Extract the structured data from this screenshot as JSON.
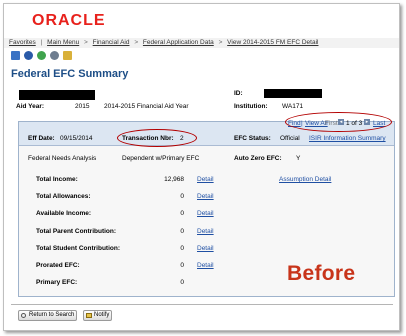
{
  "brand": {
    "logo": "ORACLE"
  },
  "nav": {
    "items": [
      "Favorites",
      "Main Menu",
      "Financial Aid",
      "Federal Application Data",
      "View 2014-2015 FM EFC Detail"
    ],
    "separator": ">"
  },
  "page": {
    "title": "Federal EFC Summary"
  },
  "header": {
    "id_label": "ID:",
    "aid_year_label": "Aid Year:",
    "aid_year_value": "2015",
    "aid_year_desc": "2014-2015 Financial Aid Year",
    "institution_label": "Institution:",
    "institution_value": "WA171"
  },
  "pager": {
    "find": "Find",
    "view_all": "View All",
    "first": "First",
    "position": "1 of 3",
    "last": "Last"
  },
  "efc": {
    "eff_date_label": "Eff Date:",
    "eff_date_value": "09/15/2014",
    "txn_label": "Transaction Nbr:",
    "txn_value": "2",
    "status_label": "EFC Status:",
    "status_value": "Official",
    "isir_link": "ISIR Information Summary",
    "analysis_label": "Federal Needs Analysis",
    "analysis_value": "Dependent w/Primary EFC",
    "auto_zero_label": "Auto Zero EFC:",
    "auto_zero_value": "Y",
    "assumption_link": "Assumption Detail",
    "detail_link": "Detail",
    "rows": [
      {
        "label": "Total Income:",
        "value": "12,968",
        "has_detail": true
      },
      {
        "label": "Total Allowances:",
        "value": "0",
        "has_detail": true
      },
      {
        "label": "Available Income:",
        "value": "0",
        "has_detail": true
      },
      {
        "label": "Total Parent Contribution:",
        "value": "0",
        "has_detail": true
      },
      {
        "label": "Total Student Contribution:",
        "value": "0",
        "has_detail": true
      },
      {
        "label": "Prorated EFC:",
        "value": "0",
        "has_detail": true
      },
      {
        "label": "Primary EFC:",
        "value": "0",
        "has_detail": false
      }
    ]
  },
  "annotation": {
    "text": "Before"
  },
  "buttons": {
    "return": "Return to Search",
    "notify": "Notify"
  },
  "colors": {
    "brand_red": "#e8211c",
    "title_blue": "#1c4d86",
    "link_blue": "#1f4fa3",
    "annotation_red": "#c8341a",
    "highlight_oval": "#b30000"
  }
}
